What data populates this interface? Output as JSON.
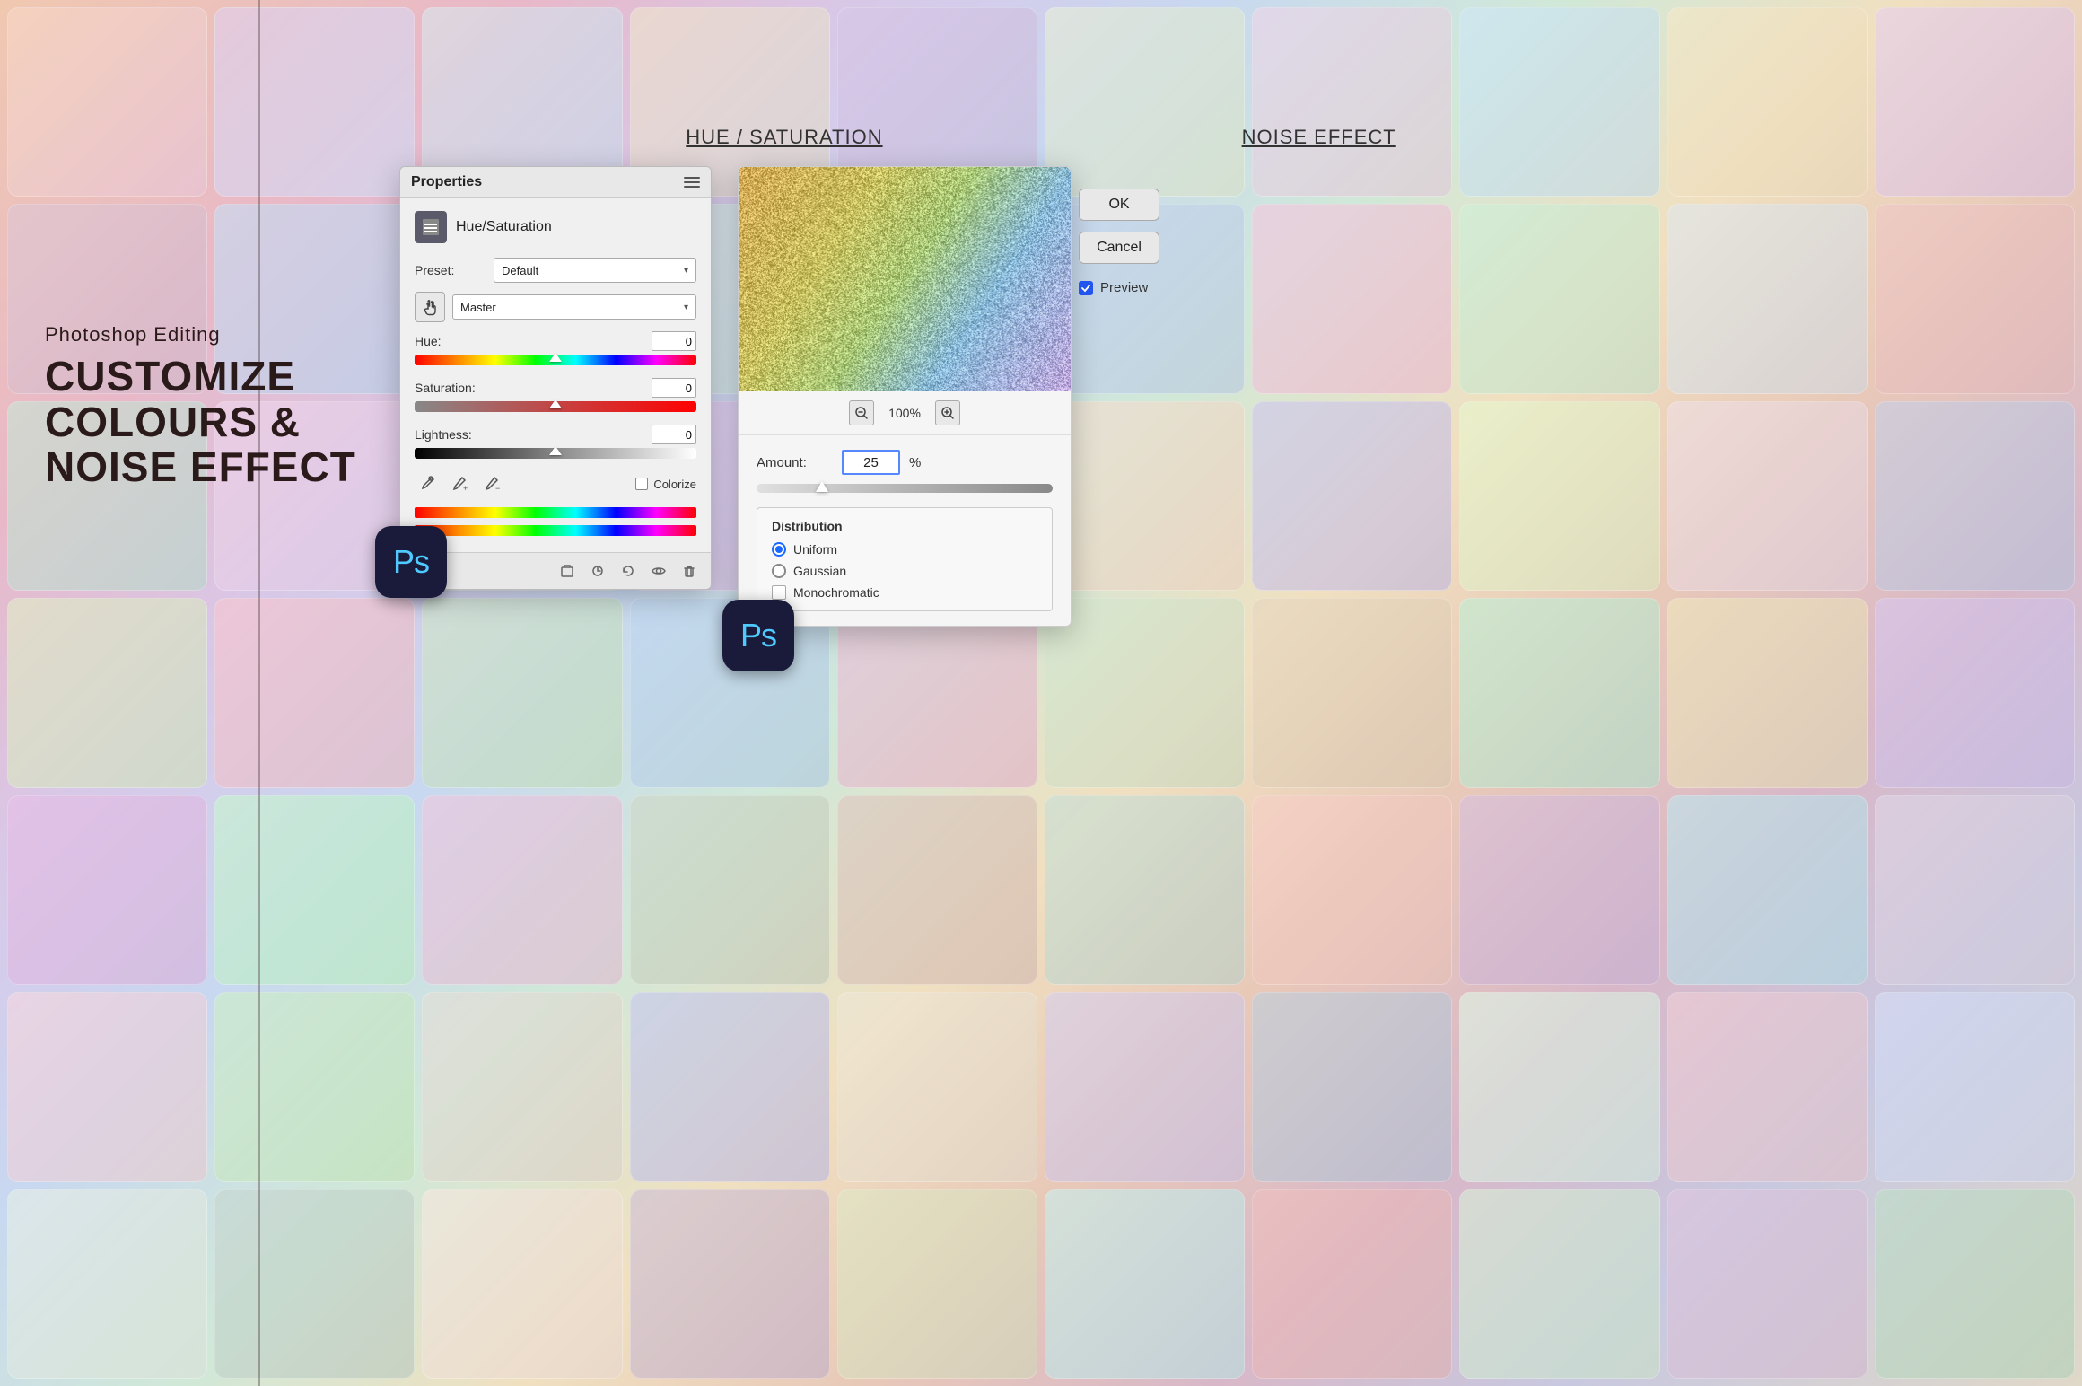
{
  "background": {
    "colors": [
      "#f0c8b0",
      "#e8b8c8",
      "#d8c8e8",
      "#c8d8f0",
      "#d0e8d8",
      "#f0e0c0"
    ]
  },
  "left_panel": {
    "subtitle": "Photoshop Editing",
    "title_line1": "CUSTOMIZE",
    "title_line2": "COLOURS &",
    "title_line3": "NOISE EFFECT"
  },
  "top_labels": {
    "hue_saturation": "HUE / SATURATION",
    "noise_effect": "NOISE EFFECT"
  },
  "properties_panel": {
    "title": "Properties",
    "menu_icon": "menu-icon",
    "header_icon": "adjustment-layer-icon",
    "header_label": "Hue/Saturation",
    "preset_label": "Preset:",
    "preset_value": "Default",
    "channel_value": "Master",
    "hue_label": "Hue:",
    "hue_value": "0",
    "saturation_label": "Saturation:",
    "saturation_value": "0",
    "lightness_label": "Lightness:",
    "lightness_value": "0",
    "colorize_label": "Colorize",
    "eyedropper1": "eyedropper-icon",
    "eyedropper2": "eyedropper-add-icon",
    "eyedropper3": "eyedropper-remove-icon",
    "footer_icons": [
      "clip-icon",
      "history-icon",
      "reset-icon",
      "visibility-icon",
      "delete-icon"
    ]
  },
  "noise_panel": {
    "zoom_value": "100%",
    "amount_label": "Amount:",
    "amount_value": "25",
    "amount_unit": "%",
    "distribution_title": "Distribution",
    "uniform_label": "Uniform",
    "gaussian_label": "Gaussian",
    "monochromatic_label": "Monochromatic",
    "uniform_selected": true,
    "ok_label": "OK",
    "cancel_label": "Cancel",
    "preview_label": "Preview",
    "preview_checked": true
  },
  "ps_badge": {
    "text": "Ps"
  }
}
